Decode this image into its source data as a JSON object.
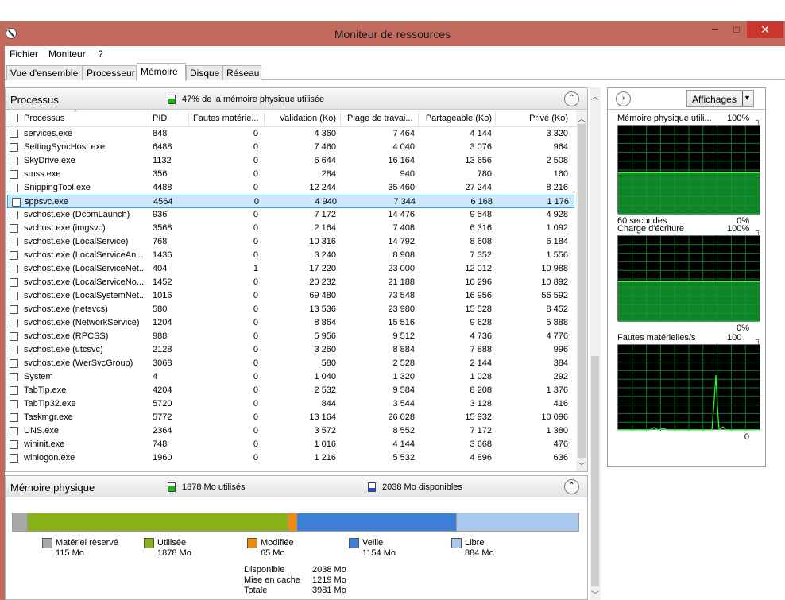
{
  "window": {
    "title": "Moniteur de ressources",
    "minimize": "─",
    "maximize": "□",
    "close": "✕"
  },
  "menu": [
    "Fichier",
    "Moniteur",
    "?"
  ],
  "tabs": [
    "Vue d'ensemble",
    "Processeur",
    "Mémoire",
    "Disque",
    "Réseau"
  ],
  "processes": {
    "title": "Processus",
    "summary": "47% de la mémoire physique utilisée",
    "summary_color": "#1db51d",
    "columns": [
      "Processus",
      "PID",
      "Fautes matérie...",
      "Validation (Ko)",
      "Plage de travai...",
      "Partageable (Ko)",
      "Privé (Ko)"
    ],
    "rows": [
      [
        "services.exe",
        "848",
        "0",
        "4 360",
        "7 464",
        "4 144",
        "3 320"
      ],
      [
        "SettingSyncHost.exe",
        "6488",
        "0",
        "7 460",
        "4 040",
        "3 076",
        "964"
      ],
      [
        "SkyDrive.exe",
        "1132",
        "0",
        "6 644",
        "16 164",
        "13 656",
        "2 508"
      ],
      [
        "smss.exe",
        "356",
        "0",
        "284",
        "940",
        "780",
        "160"
      ],
      [
        "SnippingTool.exe",
        "4488",
        "0",
        "12 244",
        "35 460",
        "27 244",
        "8 216"
      ],
      [
        "sppsvc.exe",
        "4564",
        "0",
        "4 940",
        "7 344",
        "6 168",
        "1 176"
      ],
      [
        "svchost.exe (DcomLaunch)",
        "936",
        "0",
        "7 172",
        "14 476",
        "9 548",
        "4 928"
      ],
      [
        "svchost.exe (imgsvc)",
        "3568",
        "0",
        "2 164",
        "7 408",
        "6 316",
        "1 092"
      ],
      [
        "svchost.exe (LocalService)",
        "768",
        "0",
        "10 316",
        "14 792",
        "8 608",
        "6 184"
      ],
      [
        "svchost.exe (LocalServiceAn...",
        "1436",
        "0",
        "3 240",
        "8 908",
        "7 352",
        "1 556"
      ],
      [
        "svchost.exe (LocalServiceNet...",
        "404",
        "1",
        "17 220",
        "23 000",
        "12 012",
        "10 988"
      ],
      [
        "svchost.exe (LocalServiceNo...",
        "1452",
        "0",
        "20 232",
        "21 188",
        "10 296",
        "10 892"
      ],
      [
        "svchost.exe (LocalSystemNet...",
        "1016",
        "0",
        "69 480",
        "73 548",
        "16 956",
        "56 592"
      ],
      [
        "svchost.exe (netsvcs)",
        "580",
        "0",
        "13 536",
        "23 980",
        "15 528",
        "8 452"
      ],
      [
        "svchost.exe (NetworkService)",
        "1204",
        "0",
        "8 864",
        "15 516",
        "9 628",
        "5 888"
      ],
      [
        "svchost.exe (RPCSS)",
        "988",
        "0",
        "5 956",
        "9 512",
        "4 736",
        "4 776"
      ],
      [
        "svchost.exe (utcsvc)",
        "2128",
        "0",
        "3 260",
        "8 884",
        "7 888",
        "996"
      ],
      [
        "svchost.exe (WerSvcGroup)",
        "3068",
        "0",
        "580",
        "2 528",
        "2 144",
        "384"
      ],
      [
        "System",
        "4",
        "0",
        "1 040",
        "1 320",
        "1 028",
        "292"
      ],
      [
        "TabTip.exe",
        "4204",
        "0",
        "2 532",
        "9 584",
        "8 208",
        "1 376"
      ],
      [
        "TabTip32.exe",
        "5720",
        "0",
        "844",
        "3 544",
        "3 128",
        "416"
      ],
      [
        "Taskmgr.exe",
        "5772",
        "0",
        "13 164",
        "26 028",
        "15 932",
        "10 096"
      ],
      [
        "UNS.exe",
        "2364",
        "0",
        "3 572",
        "8 552",
        "7 172",
        "1 380"
      ],
      [
        "wininit.exe",
        "748",
        "0",
        "1 016",
        "4 144",
        "3 668",
        "476"
      ],
      [
        "winlogon.exe",
        "1960",
        "0",
        "1 216",
        "5 532",
        "4 896",
        "636"
      ]
    ],
    "selected_index": 5
  },
  "physical": {
    "title": "Mémoire physique",
    "used_summary": "1878 Mo utilisés",
    "used_color": "#1db51d",
    "avail_summary": "2038 Mo disponibles",
    "avail_color": "#1f4bd6",
    "segments": [
      {
        "name": "Matériel réservé",
        "value": "115 Mo",
        "mb": 115,
        "color": "#a9a9a9"
      },
      {
        "name": "Utilisée",
        "value": "1878 Mo",
        "mb": 1878,
        "color": "#88b017"
      },
      {
        "name": "Modifiée",
        "value": "65 Mo",
        "mb": 65,
        "color": "#f08a0d"
      },
      {
        "name": "Veille",
        "value": "1154 Mo",
        "mb": 1154,
        "color": "#3d7ed6"
      },
      {
        "name": "Libre",
        "value": "884 Mo",
        "mb": 884,
        "color": "#a8c8ee"
      }
    ],
    "totals": [
      {
        "label": "Disponible",
        "value": "2038 Mo"
      },
      {
        "label": "Mise en cache",
        "value": "1219 Mo"
      },
      {
        "label": "Totale",
        "value": "3981 Mo"
      }
    ]
  },
  "right": {
    "views_button": "Affichages",
    "graphs": [
      {
        "title": "Mémoire physique utili...",
        "max": "100%",
        "footer_left": "60 secondes",
        "footer_right": "0%",
        "fill_level": 0.47
      },
      {
        "title": "Charge d'écriture",
        "max": "100%",
        "footer_left": "",
        "footer_right": "0%",
        "fill_level": 0.47
      },
      {
        "title": "Fautes matérielles/s",
        "max": "100",
        "footer_left": "",
        "footer_right": "0",
        "fill_level": 0
      }
    ]
  }
}
